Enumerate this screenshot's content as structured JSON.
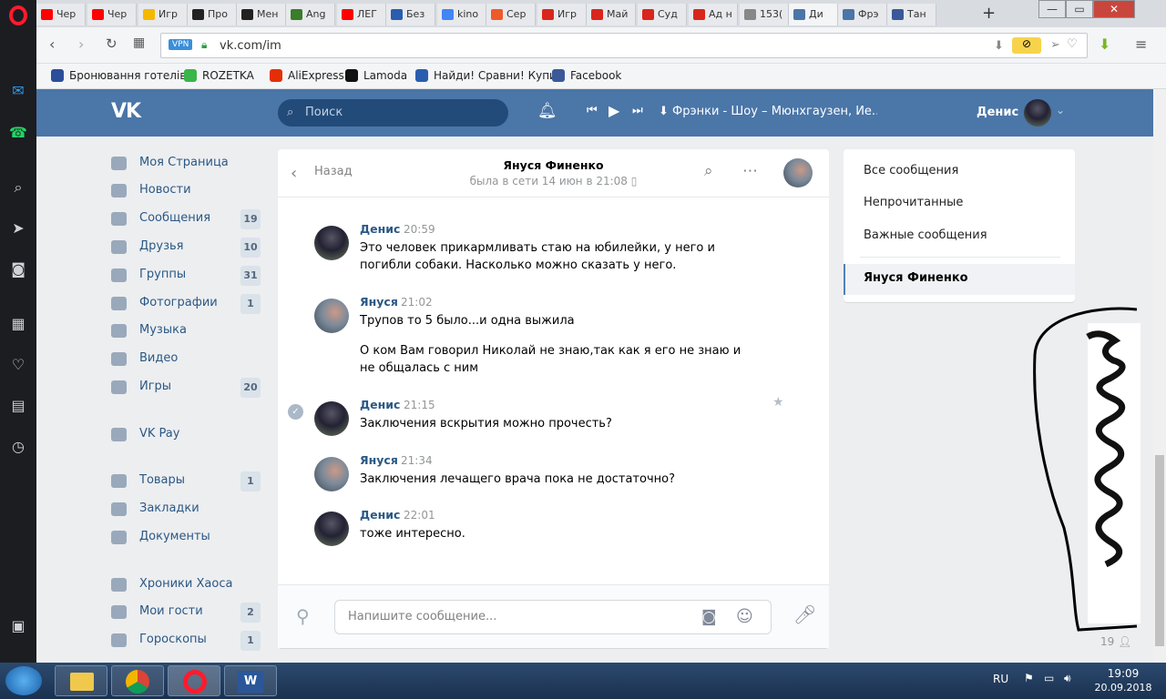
{
  "browser": {
    "tabs": [
      {
        "label": "Чер",
        "color": "#ff0000"
      },
      {
        "label": "Чер",
        "color": "#ff0000"
      },
      {
        "label": "Игр",
        "color": "#f5b800"
      },
      {
        "label": "Про",
        "color": "#222222"
      },
      {
        "label": "Мен",
        "color": "#222222"
      },
      {
        "label": "Ang",
        "color": "#3a7d2a"
      },
      {
        "label": "ЛЕГ",
        "color": "#ff0000"
      },
      {
        "label": "Без",
        "color": "#2a5db0"
      },
      {
        "label": "kino",
        "color": "#4285f4"
      },
      {
        "label": "Сер",
        "color": "#f05a28"
      },
      {
        "label": "Игр",
        "color": "#d9261c"
      },
      {
        "label": "Май",
        "color": "#d9261c"
      },
      {
        "label": "Суд",
        "color": "#d9261c"
      },
      {
        "label": "Ад н",
        "color": "#d9261c"
      },
      {
        "label": "153(",
        "color": "#888888"
      },
      {
        "label": "Ди",
        "color": "#4a76a8"
      },
      {
        "label": "Фрэ",
        "color": "#4a76a8"
      },
      {
        "label": "Тан",
        "color": "#3b5998"
      }
    ],
    "active_tab_index": 15,
    "new_tab": "+",
    "window_controls": {
      "minimize": "—",
      "maximize": "▭",
      "close": "✕"
    },
    "vpn_badge": "VPN",
    "url": "vk.com/im",
    "bookmarks": [
      {
        "label": "Бронювання готелів",
        "color": "#2b4e9b"
      },
      {
        "label": "ROZETKA",
        "color": "#39b54a"
      },
      {
        "label": "AliExpress",
        "color": "#e62e04"
      },
      {
        "label": "Lamoda",
        "color": "#111111"
      },
      {
        "label": "Найди! Сравни! Купи",
        "color": "#2a5db0"
      },
      {
        "label": "Facebook",
        "color": "#3b5998"
      }
    ]
  },
  "header": {
    "logo": "VK",
    "search_placeholder": "Поиск",
    "now_playing": "Фрэнки - Шоу – Мюнхгаузен, Ие...",
    "user_name": "Денис"
  },
  "nav": [
    {
      "label": "Моя Страница",
      "count": ""
    },
    {
      "label": "Новости",
      "count": ""
    },
    {
      "label": "Сообщения",
      "count": "19"
    },
    {
      "label": "Друзья",
      "count": "10"
    },
    {
      "label": "Группы",
      "count": "31"
    },
    {
      "label": "Фотографии",
      "count": "1"
    },
    {
      "label": "Музыка",
      "count": ""
    },
    {
      "label": "Видео",
      "count": ""
    },
    {
      "label": "Игры",
      "count": "20"
    },
    {
      "label": "VK Pay",
      "count": ""
    },
    {
      "label": "Товары",
      "count": "1"
    },
    {
      "label": "Закладки",
      "count": ""
    },
    {
      "label": "Документы",
      "count": ""
    },
    {
      "label": "Хроники Хаоса",
      "count": ""
    },
    {
      "label": "Мои гости",
      "count": "2"
    },
    {
      "label": "Гороскопы",
      "count": "1"
    }
  ],
  "chat": {
    "back_label": "Назад",
    "contact_name": "Януся Финенко",
    "status": "была в сети 14 июн в 21:08",
    "messages": [
      {
        "author": "Денис",
        "time": "20:59",
        "text": "Это человек прикармливать стаю на юбилейки, у него и погибли собаки. Насколько можно сказать у него."
      },
      {
        "author": "Януся",
        "time": "21:02",
        "text": "Трупов то 5 было...и одна выжила"
      },
      {
        "author": "",
        "time": "",
        "text": "О ком Вам говорил Николай не знаю,так как я его не знаю и не общалась с ним"
      },
      {
        "author": "Денис",
        "time": "21:15",
        "text": "Заключения вскрытия можно прочесть?"
      },
      {
        "author": "Януся",
        "time": "21:34",
        "text": "Заключения лечащего врача пока не достаточно?"
      },
      {
        "author": "Денис",
        "time": "22:01",
        "text": "тоже интересно."
      }
    ],
    "input_placeholder": "Напишите сообщение..."
  },
  "right_menu": {
    "all": "Все сообщения",
    "unread": "Непрочитанные",
    "important": "Важные сообщения",
    "selected": "Януся Финенко"
  },
  "right_panel_count": "19",
  "taskbar": {
    "language": "RU",
    "time": "19:09",
    "date": "20.09.2018"
  },
  "colors": {
    "vk_blue": "#4a76a8",
    "link": "#2a5885",
    "page_bg": "#edeef0"
  }
}
